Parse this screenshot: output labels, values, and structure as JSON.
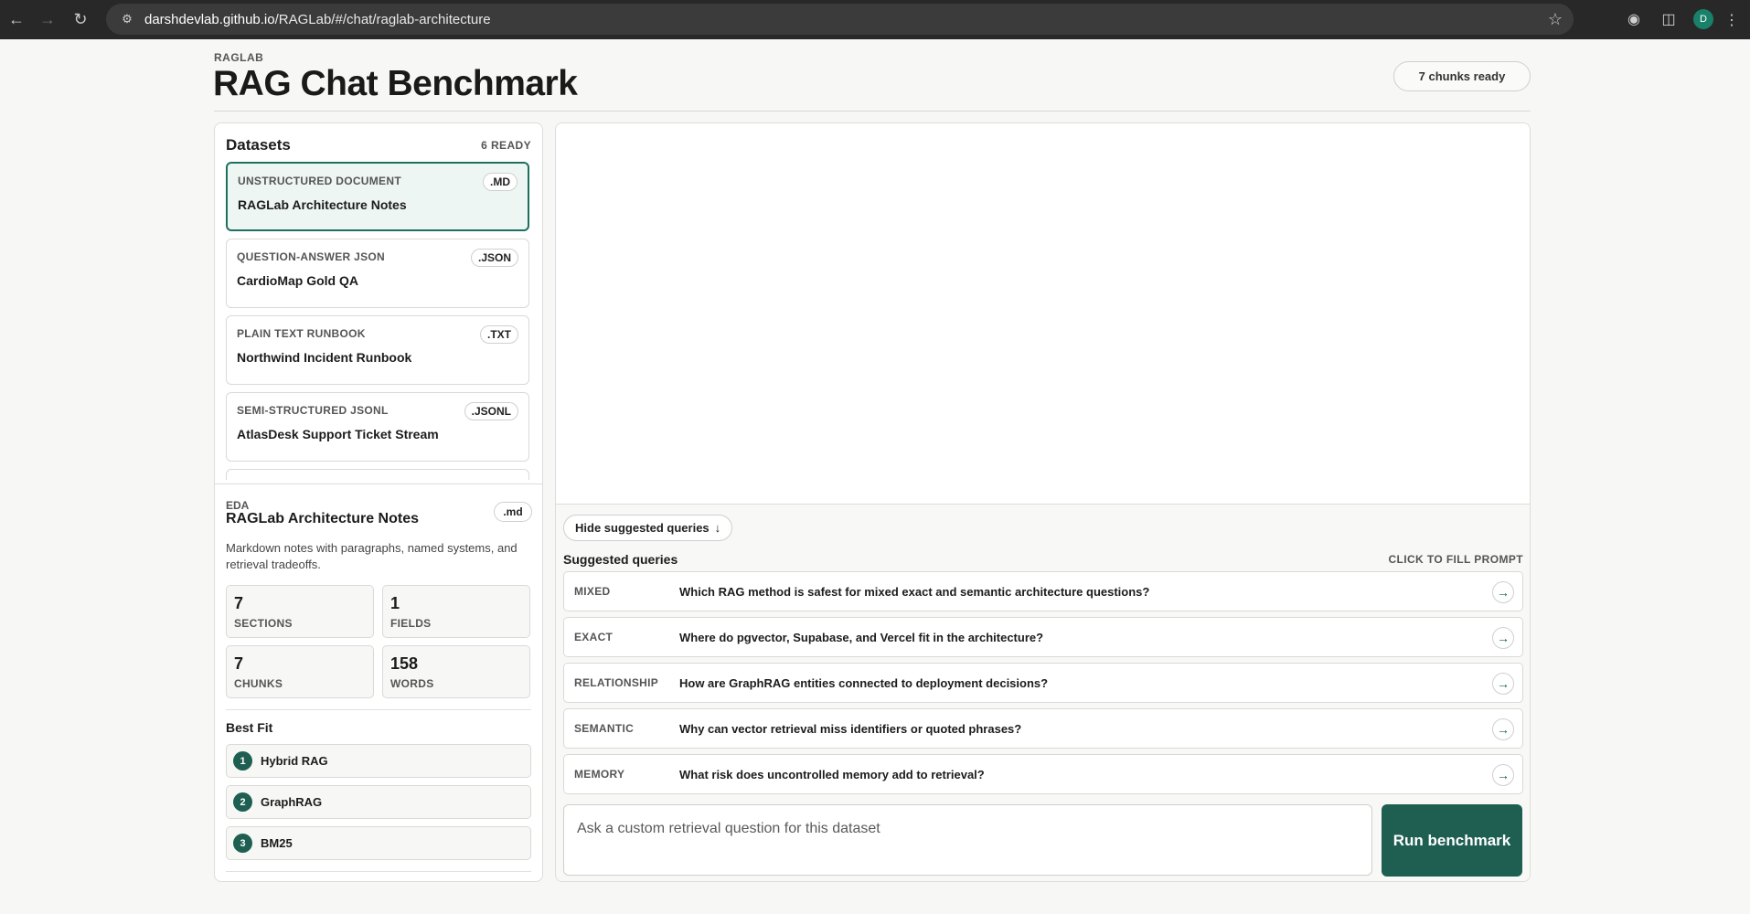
{
  "browser": {
    "url_host": "darshdevlab.github.io",
    "url_path": "/RAGLab/#/chat/raglab-architecture",
    "avatar_letter": "D",
    "icons": [
      "back-icon",
      "forward-icon",
      "reload-icon",
      "site-settings-icon",
      "bookmark-star-icon",
      "extension-icon",
      "puzzle-icon",
      "menu-icon"
    ]
  },
  "header": {
    "brand": "RAGLAB",
    "title": "RAG Chat Benchmark",
    "status": "7 chunks ready"
  },
  "datasets": {
    "title": "Datasets",
    "count": "6 READY",
    "items": [
      {
        "type": "UNSTRUCTURED DOCUMENT",
        "name": "RAGLab Architecture Notes",
        "ext": ".MD",
        "active": true
      },
      {
        "type": "QUESTION-ANSWER JSON",
        "name": "CardioMap Gold QA",
        "ext": ".JSON",
        "active": false
      },
      {
        "type": "PLAIN TEXT RUNBOOK",
        "name": "Northwind Incident Runbook",
        "ext": ".TXT",
        "active": false
      },
      {
        "type": "SEMI-STRUCTURED JSONL",
        "name": "AtlasDesk Support Ticket Stream",
        "ext": ".JSONL",
        "active": false
      }
    ]
  },
  "eda": {
    "label": "EDA",
    "title": "RAGLab Architecture Notes",
    "ext": ".md",
    "description": "Markdown notes with paragraphs, named systems, and retrieval tradeoffs.",
    "stats": [
      {
        "value": "7",
        "label": "SECTIONS"
      },
      {
        "value": "1",
        "label": "FIELDS"
      },
      {
        "value": "7",
        "label": "CHUNKS"
      },
      {
        "value": "158",
        "label": "WORDS"
      }
    ],
    "best_fit_title": "Best Fit",
    "best_fit": [
      {
        "rank": "1",
        "name": "Hybrid RAG"
      },
      {
        "rank": "2",
        "name": "GraphRAG"
      },
      {
        "rank": "3",
        "name": "BM25"
      }
    ]
  },
  "chat": {
    "hide_button": "Hide suggested queries",
    "suggested_title": "Suggested queries",
    "suggested_hint": "CLICK TO FILL PROMPT",
    "queries": [
      {
        "category": "MIXED",
        "text": "Which RAG method is safest for mixed exact and semantic architecture questions?"
      },
      {
        "category": "EXACT",
        "text": "Where do pgvector, Supabase, and Vercel fit in the architecture?"
      },
      {
        "category": "RELATIONSHIP",
        "text": "How are GraphRAG entities connected to deployment decisions?"
      },
      {
        "category": "SEMANTIC",
        "text": "Why can vector retrieval miss identifiers or quoted phrases?"
      },
      {
        "category": "MEMORY",
        "text": "What risk does uncontrolled memory add to retrieval?"
      }
    ],
    "prompt_placeholder": "Ask a custom retrieval question for this dataset",
    "prompt_value": "",
    "run_button": "Run benchmark"
  },
  "colors": {
    "accent": "#1f5f52",
    "active_card_bg": "#eef6f3",
    "chrome_bg": "#282828"
  }
}
